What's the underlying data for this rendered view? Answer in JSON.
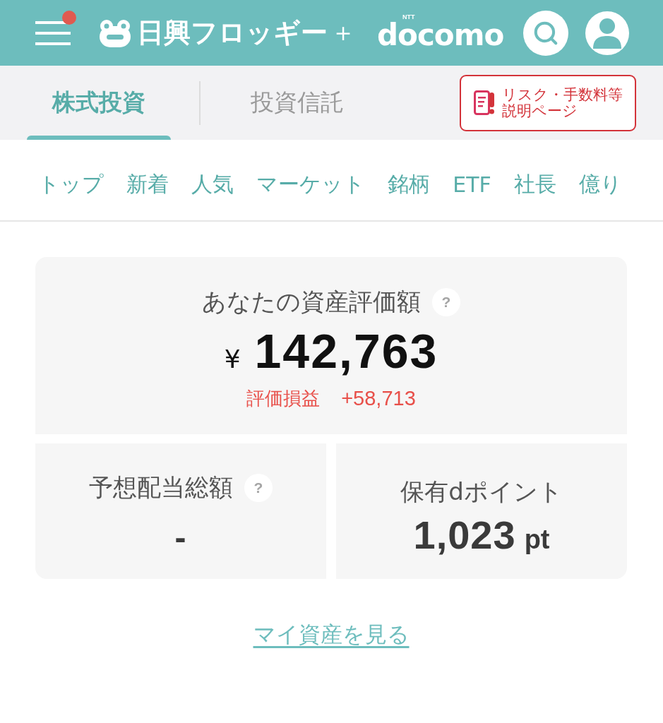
{
  "header": {
    "menu": {
      "notification": true
    },
    "logo": {
      "name": "日興フロッギー",
      "plus": "＋",
      "partner_mark": "NTT",
      "partner": "docomo"
    }
  },
  "tabs": [
    {
      "label": "株式投資",
      "selected": true
    },
    {
      "label": "投資信託",
      "selected": false
    }
  ],
  "risk_button": {
    "lines": [
      "リスク・手数料等",
      "説明ページ"
    ]
  },
  "subnav": [
    "トップ",
    "新着",
    "人気",
    "マーケット",
    "銘柄",
    "ETF",
    "社長",
    "億り"
  ],
  "asset_summary": {
    "title": "あなたの資産評価額",
    "help": "?",
    "currency": "¥",
    "value": "142,763",
    "gain_label": "評価損益",
    "gain_value": "+58,713"
  },
  "stats": [
    {
      "title": "予想配当総額",
      "help": "?",
      "value": "-"
    },
    {
      "title": "保有dポイント",
      "value": "1,023",
      "unit": "pt"
    }
  ],
  "link": "マイ資産を見る"
}
